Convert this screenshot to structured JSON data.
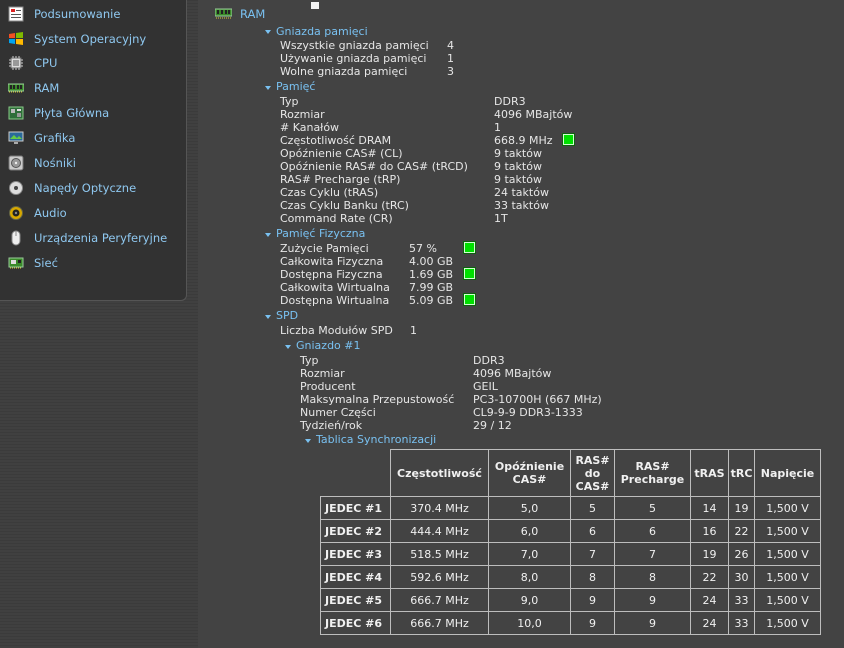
{
  "sidebar": {
    "items": [
      {
        "label": "Podsumowanie",
        "icon": "summary-icon"
      },
      {
        "label": "System Operacyjny",
        "icon": "windows-logo-icon"
      },
      {
        "label": "CPU",
        "icon": "cpu-icon"
      },
      {
        "label": "RAM",
        "icon": "ram-icon"
      },
      {
        "label": "Płyta Główna",
        "icon": "motherboard-icon"
      },
      {
        "label": "Grafika",
        "icon": "monitor-icon"
      },
      {
        "label": "Nośniki",
        "icon": "hard-drive-icon"
      },
      {
        "label": "Napędy Optyczne",
        "icon": "optical-disc-icon"
      },
      {
        "label": "Audio",
        "icon": "speaker-icon"
      },
      {
        "label": "Urządzenia Peryferyjne",
        "icon": "mouse-icon"
      },
      {
        "label": "Sieć",
        "icon": "network-card-icon"
      }
    ]
  },
  "colors": {
    "accent": "#79c1f1",
    "status_ok": "#00e000"
  },
  "page": {
    "title": "RAM",
    "icon": "ram-icon"
  },
  "slots": {
    "heading": "Gniazda pamięci",
    "rows": [
      {
        "label": "Wszystkie gniazda pamięci",
        "value": "4"
      },
      {
        "label": "Używanie gniazda pamięci",
        "value": "1"
      },
      {
        "label": "Wolne gniazda pamięci",
        "value": "3"
      }
    ]
  },
  "memory": {
    "heading": "Pamięć",
    "rows": [
      {
        "label": "Typ",
        "value": "DDR3"
      },
      {
        "label": "Rozmiar",
        "value": "4096 MBajtów"
      },
      {
        "label": "# Kanałów",
        "value": "1"
      },
      {
        "label": "Częstotliwość DRAM",
        "value": "668.9 MHz"
      },
      {
        "label": "Opóźnienie CAS# (CL)",
        "value": "9 taktów"
      },
      {
        "label": "Opóźnienie RAS# do CAS# (tRCD)",
        "value": "9 taktów"
      },
      {
        "label": "RAS# Precharge (tRP)",
        "value": "9 taktów"
      },
      {
        "label": "Czas Cyklu (tRAS)",
        "value": "24 taktów"
      },
      {
        "label": "Czas Cyklu Banku (tRC)",
        "value": "33 taktów"
      },
      {
        "label": "Command Rate (CR)",
        "value": "1T"
      }
    ]
  },
  "physical": {
    "heading": "Pamięć Fizyczna",
    "rows": [
      {
        "label": "Zużycie Pamięci",
        "value": "57 %"
      },
      {
        "label": "Całkowita Fizyczna",
        "value": "4.00 GB"
      },
      {
        "label": "Dostępna Fizyczna",
        "value": "1.69 GB"
      },
      {
        "label": "Całkowita Wirtualna",
        "value": "7.99 GB"
      },
      {
        "label": "Dostępna Wirtualna",
        "value": "5.09 GB"
      }
    ]
  },
  "spd": {
    "heading": "SPD",
    "modules_label": "Liczba Modułów SPD",
    "modules_value": "1",
    "slot_heading": "Gniazdo #1",
    "rows": [
      {
        "label": "Typ",
        "value": "DDR3"
      },
      {
        "label": "Rozmiar",
        "value": "4096 MBajtów"
      },
      {
        "label": "Producent",
        "value": "GEIL"
      },
      {
        "label": "Maksymalna Przepustowość",
        "value": "PC3-10700H (667 MHz)"
      },
      {
        "label": "Numer Części",
        "value": "CL9-9-9 DDR3-1333"
      },
      {
        "label": "Tydzień/rok",
        "value": "29 / 12"
      }
    ],
    "timing_heading": "Tablica Synchronizacji"
  },
  "timing_table": {
    "headers": [
      "Częstotliwość",
      "Opóźnienie CAS#",
      "RAS# do CAS#",
      "RAS# Precharge",
      "tRAS",
      "tRC",
      "Napięcie"
    ],
    "rows": [
      {
        "name": "JEDEC #1",
        "cells": [
          "370.4 MHz",
          "5,0",
          "5",
          "5",
          "14",
          "19",
          "1,500 V"
        ]
      },
      {
        "name": "JEDEC #2",
        "cells": [
          "444.4 MHz",
          "6,0",
          "6",
          "6",
          "16",
          "22",
          "1,500 V"
        ]
      },
      {
        "name": "JEDEC #3",
        "cells": [
          "518.5 MHz",
          "7,0",
          "7",
          "7",
          "19",
          "26",
          "1,500 V"
        ]
      },
      {
        "name": "JEDEC #4",
        "cells": [
          "592.6 MHz",
          "8,0",
          "8",
          "8",
          "22",
          "30",
          "1,500 V"
        ]
      },
      {
        "name": "JEDEC #5",
        "cells": [
          "666.7 MHz",
          "9,0",
          "9",
          "9",
          "24",
          "33",
          "1,500 V"
        ]
      },
      {
        "name": "JEDEC #6",
        "cells": [
          "666.7 MHz",
          "10,0",
          "9",
          "9",
          "24",
          "33",
          "1,500 V"
        ]
      }
    ]
  }
}
